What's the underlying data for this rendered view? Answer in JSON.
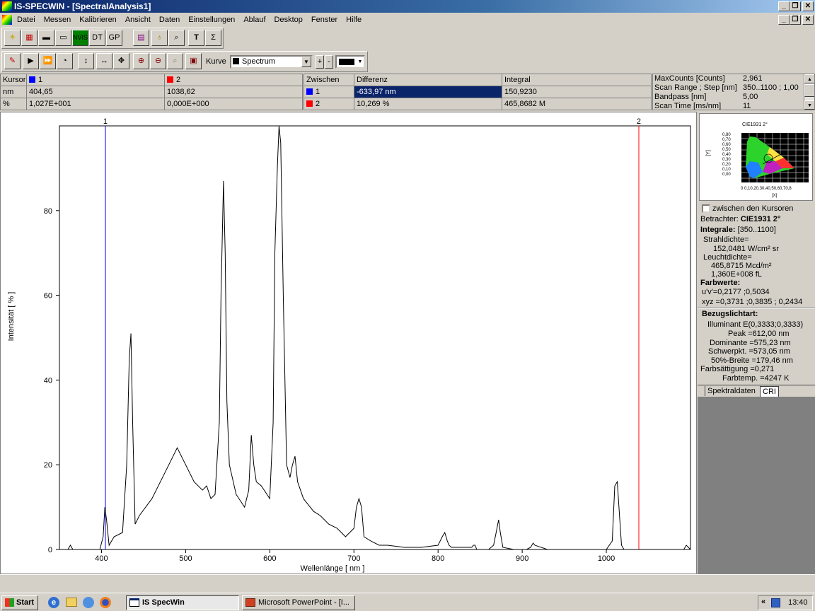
{
  "window": {
    "title": "IS-SPECWIN - [SpectralAnalysis1]"
  },
  "menu": [
    "Datei",
    "Messen",
    "Kalibrieren",
    "Ansicht",
    "Daten",
    "Einstellungen",
    "Ablauf",
    "Desktop",
    "Fenster",
    "Hilfe"
  ],
  "toolbar1": [
    "NVIS",
    "DT",
    "GP"
  ],
  "toolbar2": {
    "kurve_label": "Kurve",
    "kurve_value": "Spectrum"
  },
  "cursor_table": {
    "headers": [
      "Kursor",
      "1",
      "2"
    ],
    "rows": [
      [
        "nm",
        "404,65",
        "1038,62"
      ],
      [
        "%",
        "1,027E+001",
        "0,000E+000"
      ]
    ]
  },
  "diff_table": {
    "headers": [
      "Zwischen",
      "Differenz",
      "Integral"
    ],
    "rows": [
      [
        "1",
        "-633,97 nm",
        "150,9230"
      ],
      [
        "2",
        "10,269 %",
        "465,8682 M"
      ]
    ]
  },
  "info_table": {
    "rows": [
      [
        "MaxCounts [Counts]",
        "2,961"
      ],
      [
        "Scan Range ; Step [nm]",
        "350..1100 ; 1,00"
      ],
      [
        "Bandpass [nm]",
        "5,00"
      ],
      [
        "Scan Time [ms/nm]",
        "11"
      ]
    ]
  },
  "colors": {
    "cursor1": "#0000ff",
    "cursor2": "#ff0000",
    "selection": "#0a246a"
  },
  "cie": {
    "title": "CIE1931 2°",
    "ylabel": "[Y]",
    "xlabel": "[X]",
    "yticks": [
      "0,80",
      "0,70",
      "0,60",
      "0,50",
      "0,40",
      "0,30",
      "0,20",
      "0,10",
      "0,00"
    ],
    "xticks": "0 0,10,20,30,40,50,60,70,8"
  },
  "panel": {
    "checkbox_label": "zwischen den Kursoren",
    "betrachter_label": "Betrachter:",
    "betrachter_value": "CIE1931 2°",
    "integrale_label": "Integrale:",
    "integrale_value": "[350..1100]",
    "strahldichte_label": "Strahldichte=",
    "strahldichte_value": "152,0481 W/cm² sr",
    "leuchtdichte_label": "Leuchtdichte=",
    "leuchtdichte_value1": "465,8715 Mcd/m²",
    "leuchtdichte_value2": "1,360E+008 fL",
    "farbwerte_label": "Farbwerte:",
    "uv": "u'v'=0,2177 ;0,5034",
    "xyz": "xyz =0,3731 ;0,3835 ;  0,2434",
    "bezug_label": "Bezugslichtart:",
    "illuminant": "Illuminant E(0,3333;0,3333)",
    "peak": "Peak =612,00 nm",
    "dominante": "Dominante =575,23 nm",
    "schwerpkt": "Schwerpkt. =573,05 nm",
    "breite": "50%-Breite =179,46 nm",
    "saettigung": "Farbsättigung =0,271",
    "farbtemp": "Farbtemp. =4247 K",
    "tabs": [
      "Spektraldaten",
      "CRI"
    ]
  },
  "chart_data": {
    "type": "line",
    "xlabel": "Wellenlänge [ nm ]",
    "ylabel": "Intensität [ % ]",
    "xlim": [
      350,
      1100
    ],
    "ylim": [
      0,
      100
    ],
    "xticks": [
      400,
      500,
      600,
      700,
      800,
      900,
      1000
    ],
    "yticks": [
      0,
      20,
      40,
      60,
      80
    ],
    "cursors": [
      {
        "label": "1",
        "x": 404.65
      },
      {
        "label": "2",
        "x": 1038.62
      }
    ],
    "series": [
      {
        "x": [
          350,
          360,
          363,
          366,
          370,
          390,
          398,
          402,
          404,
          406,
          409,
          415,
          425,
          430,
          433,
          435,
          437,
          440,
          445,
          460,
          475,
          485,
          490,
          500,
          510,
          520,
          525,
          530,
          535,
          540,
          542,
          545,
          547,
          549,
          552,
          560,
          570,
          575,
          578,
          581,
          584,
          590,
          600,
          604,
          606,
          609,
          611,
          613,
          616,
          620,
          624,
          627,
          630,
          633,
          640,
          648,
          652,
          660,
          670,
          680,
          690,
          700,
          703,
          706,
          709,
          712,
          720,
          730,
          740,
          760,
          780,
          800,
          805,
          808,
          811,
          813,
          816,
          830,
          840,
          842,
          844,
          846,
          860,
          866,
          869,
          872,
          874,
          877,
          890,
          905,
          910,
          913,
          915,
          930,
          960,
          1000,
          1007,
          1010,
          1013,
          1015,
          1018,
          1021,
          1040,
          1080,
          1092,
          1095,
          1100
        ],
        "y": [
          0,
          0,
          1,
          0,
          0,
          0,
          0,
          3,
          10,
          7,
          1,
          3,
          4,
          20,
          45,
          51,
          30,
          6,
          8,
          12,
          18,
          22,
          24,
          20,
          16,
          14,
          15,
          12,
          13,
          30,
          60,
          87,
          70,
          35,
          20,
          13,
          10,
          14,
          27,
          20,
          16,
          15,
          12,
          30,
          70,
          90,
          100,
          96,
          60,
          20,
          17,
          20,
          22,
          16,
          12,
          10,
          9,
          8,
          6,
          5,
          3,
          5,
          10,
          12,
          10,
          3,
          2,
          1,
          1,
          0.5,
          0.5,
          1,
          3,
          4,
          2,
          1,
          0.5,
          0.5,
          0.5,
          1,
          1,
          0,
          0,
          1,
          4,
          7,
          4,
          0.5,
          0,
          0,
          0.5,
          1.5,
          1,
          0,
          0,
          0,
          2,
          15,
          16,
          10,
          1,
          0,
          0,
          0,
          0,
          1,
          0
        ]
      }
    ]
  },
  "status": {
    "text": ""
  },
  "taskbar": {
    "start": "Start",
    "tasks": [
      "IS SpecWin",
      "Microsoft PowerPoint - [I..."
    ],
    "clock": "13:40"
  }
}
